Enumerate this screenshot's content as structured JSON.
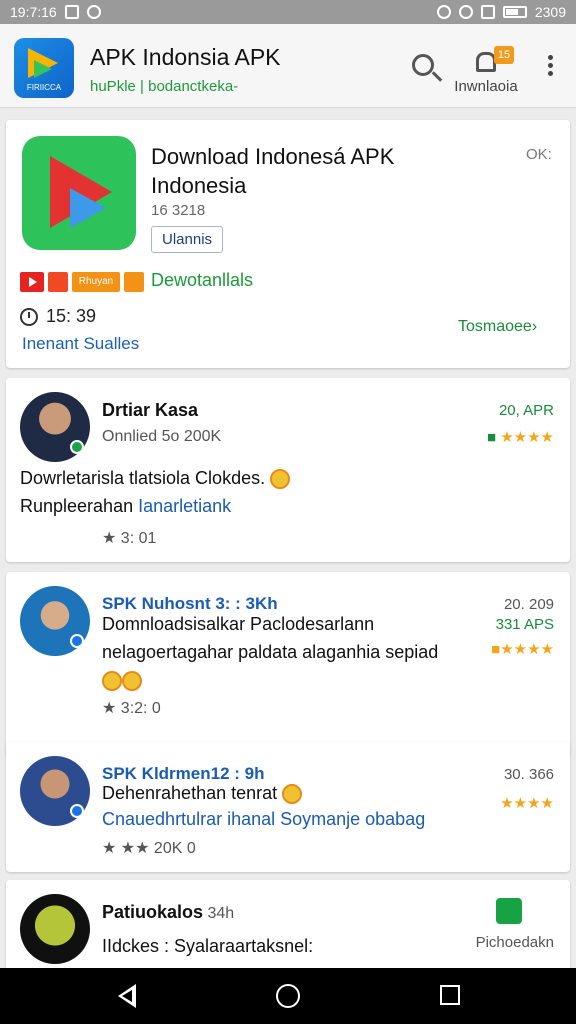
{
  "status": {
    "time": "19:7:16",
    "right_text": "2309"
  },
  "header": {
    "logo_text": "FIRIICCA",
    "title": "APK Indonsia APK",
    "subtitle": "huPkle | bodanctkeka-",
    "notif_badge": "15",
    "notif_label": "Inwnlaoia"
  },
  "hero": {
    "title": "Download Indonesá APK Indonesia",
    "ok": "OK:",
    "version": "16 3218",
    "chip": "Ulannis",
    "badge_text": "Rhuyan",
    "green_text": "Dewotanllals",
    "time": "15: 39",
    "link": "Inenant Sualles",
    "action": "Tosmaoee›"
  },
  "posts": [
    {
      "name": "Drtiar Kasa",
      "sub": "Onnlied 5o 200K",
      "date": "20, APR",
      "stars": "★★★★",
      "text1": "Dowrletarisla tlatsiola Clokdes.",
      "text2_a": "Runpleerahan ",
      "text2_b": "Ianarletiank",
      "meta": "3: 01"
    },
    {
      "name": "SPK Nuhosnt 3: : 3Kh",
      "text": "Domnloadsisalkar Paclodesarlann nelagoertagahar paldata alaganhia sepiad",
      "date": "20. 209",
      "date2": "331 APS",
      "stars": "★★★★",
      "meta": "3:2: 0"
    },
    {
      "name": "SPK Kldrmen12 : 9h",
      "text1": "Dehenrahethan tenrat",
      "text2": "Cnauedhrtulrar ihanal Soymanje obabag",
      "date": "30. 366",
      "stars": "★★★★",
      "meta": "★★ 20K 0"
    },
    {
      "name": "Patiuokalos",
      "name_suffix": " 34h",
      "text": "IIdckes : Syalaraartaksnel:",
      "side_label": "Pichoedakn"
    }
  ]
}
